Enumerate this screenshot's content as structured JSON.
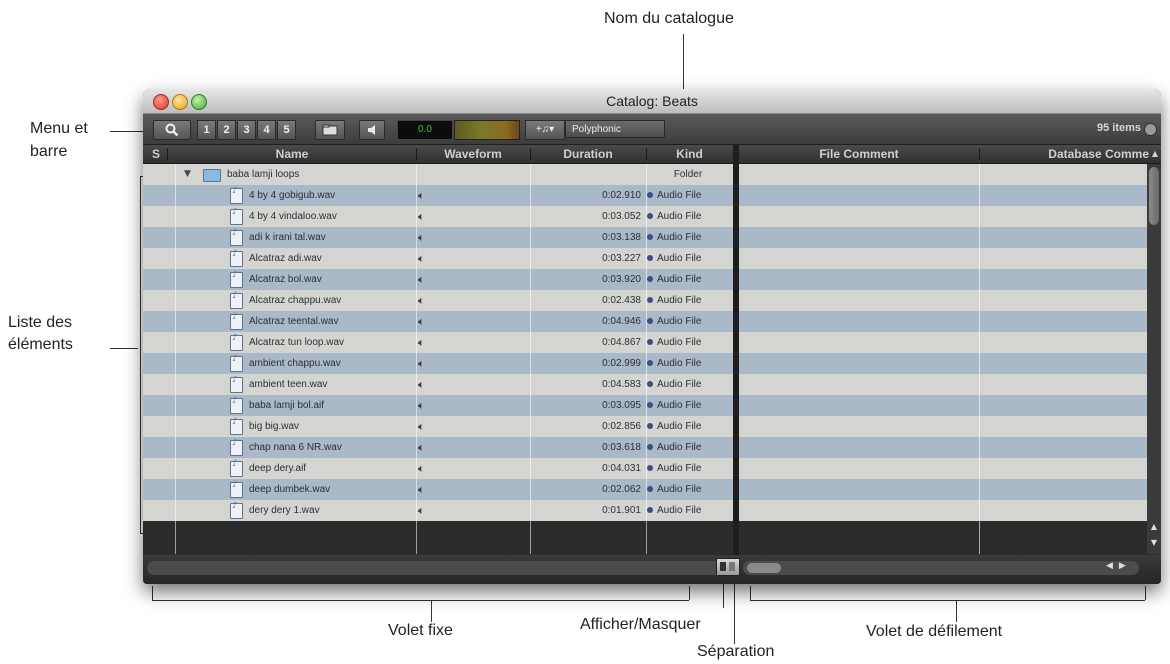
{
  "annotations": {
    "catalog_name": "Nom du catalogue",
    "menu_bar": [
      "Menu et",
      "barre"
    ],
    "item_list": [
      "Liste des",
      "éléments"
    ],
    "fixed_pane": "Volet fixe",
    "show_hide": "Afficher/Masquer",
    "separation": "Séparation",
    "scroll_pane": "Volet de défilement"
  },
  "window": {
    "title": "Catalog: Beats"
  },
  "toolbar": {
    "search_icon": "search-icon",
    "numbers": [
      "1",
      "2",
      "3",
      "4",
      "5"
    ],
    "level": "0.0",
    "mode": "+♫▾",
    "voice": "Polyphonic",
    "item_count": "95 items"
  },
  "columns": {
    "s": "S",
    "name": "Name",
    "waveform": "Waveform",
    "duration": "Duration",
    "kind": "Kind",
    "file_comment": "File Comment",
    "database_comment": "Database Comme"
  },
  "folder_row": {
    "name": "baba lamji loops",
    "kind": "Folder"
  },
  "files": [
    {
      "name": "4 by 4 gobigub.wav",
      "duration": "0:02.910",
      "kind": "Audio File"
    },
    {
      "name": "4 by 4 vindaloo.wav",
      "duration": "0:03.052",
      "kind": "Audio File"
    },
    {
      "name": "adi k irani tal.wav",
      "duration": "0:03.138",
      "kind": "Audio File"
    },
    {
      "name": "Alcatraz adi.wav",
      "duration": "0:03.227",
      "kind": "Audio File"
    },
    {
      "name": "Alcatraz bol.wav",
      "duration": "0:03.920",
      "kind": "Audio File"
    },
    {
      "name": "Alcatraz chappu.wav",
      "duration": "0:02.438",
      "kind": "Audio File"
    },
    {
      "name": "Alcatraz teental.wav",
      "duration": "0:04.946",
      "kind": "Audio File"
    },
    {
      "name": "Alcatraz tun loop.wav",
      "duration": "0:04.867",
      "kind": "Audio File"
    },
    {
      "name": "ambient chappu.wav",
      "duration": "0:02.999",
      "kind": "Audio File"
    },
    {
      "name": "ambient teen.wav",
      "duration": "0:04.583",
      "kind": "Audio File"
    },
    {
      "name": "baba lamji bol.aif",
      "duration": "0:03.095",
      "kind": "Audio File"
    },
    {
      "name": "big big.wav",
      "duration": "0:02.856",
      "kind": "Audio File"
    },
    {
      "name": "chap nana 6 NR.wav",
      "duration": "0:03.618",
      "kind": "Audio File"
    },
    {
      "name": "deep dery.aif",
      "duration": "0:04.031",
      "kind": "Audio File"
    },
    {
      "name": "deep dumbek.wav",
      "duration": "0:02.062",
      "kind": "Audio File"
    },
    {
      "name": "dery dery 1.wav",
      "duration": "0:01.901",
      "kind": "Audio File"
    }
  ],
  "icons": {
    "file": "audio-file-icon",
    "folder": "folder-icon",
    "waveform": "speaker-icon"
  }
}
